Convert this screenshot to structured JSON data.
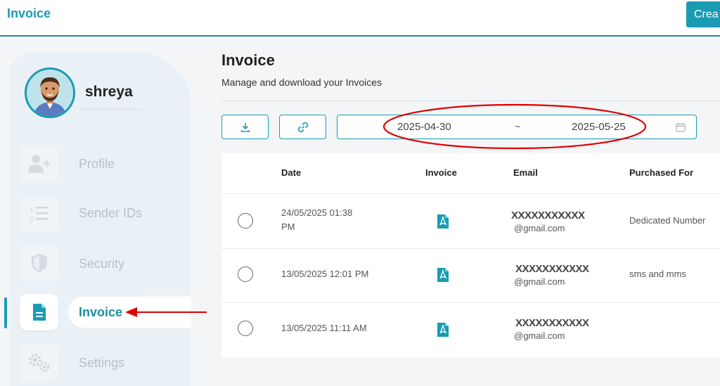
{
  "header": {
    "brand": "Invoice",
    "create_label": "Crea"
  },
  "user": {
    "name": "shreya"
  },
  "sidebar": {
    "items": [
      {
        "label": "Profile",
        "icon": "user-plus-icon"
      },
      {
        "label": "Sender IDs",
        "icon": "numbered-list-icon"
      },
      {
        "label": "Security",
        "icon": "shield-icon"
      },
      {
        "label": "Invoice",
        "icon": "document-icon",
        "active": true
      },
      {
        "label": "Settings",
        "icon": "gears-icon"
      }
    ]
  },
  "main": {
    "title": "Invoice",
    "subtitle": "Manage and download your Invoices",
    "date_range": {
      "start": "2025-04-30",
      "separator": "~",
      "end": "2025-05-25"
    }
  },
  "table": {
    "columns": [
      "Date",
      "Invoice",
      "Email",
      "Purchased For"
    ],
    "rows": [
      {
        "date_line1": "24/05/2025 01:38",
        "date_line2": "PM",
        "email_mask": "XXXXXXXXXXX",
        "email_domain": "@gmail.com",
        "purchased_for": "Dedicated Number"
      },
      {
        "date_line1": "13/05/2025 12:01 PM",
        "date_line2": "",
        "email_mask": "XXXXXXXXXXX",
        "email_domain": "@gmail.com",
        "purchased_for": "sms and mms"
      },
      {
        "date_line1": "13/05/2025 11:11 AM",
        "date_line2": "",
        "email_mask": "XXXXXXXXXXX",
        "email_domain": "@gmail.com",
        "purchased_for": ""
      }
    ]
  },
  "colors": {
    "accent": "#1a9bb3",
    "annotation": "#e00000"
  }
}
